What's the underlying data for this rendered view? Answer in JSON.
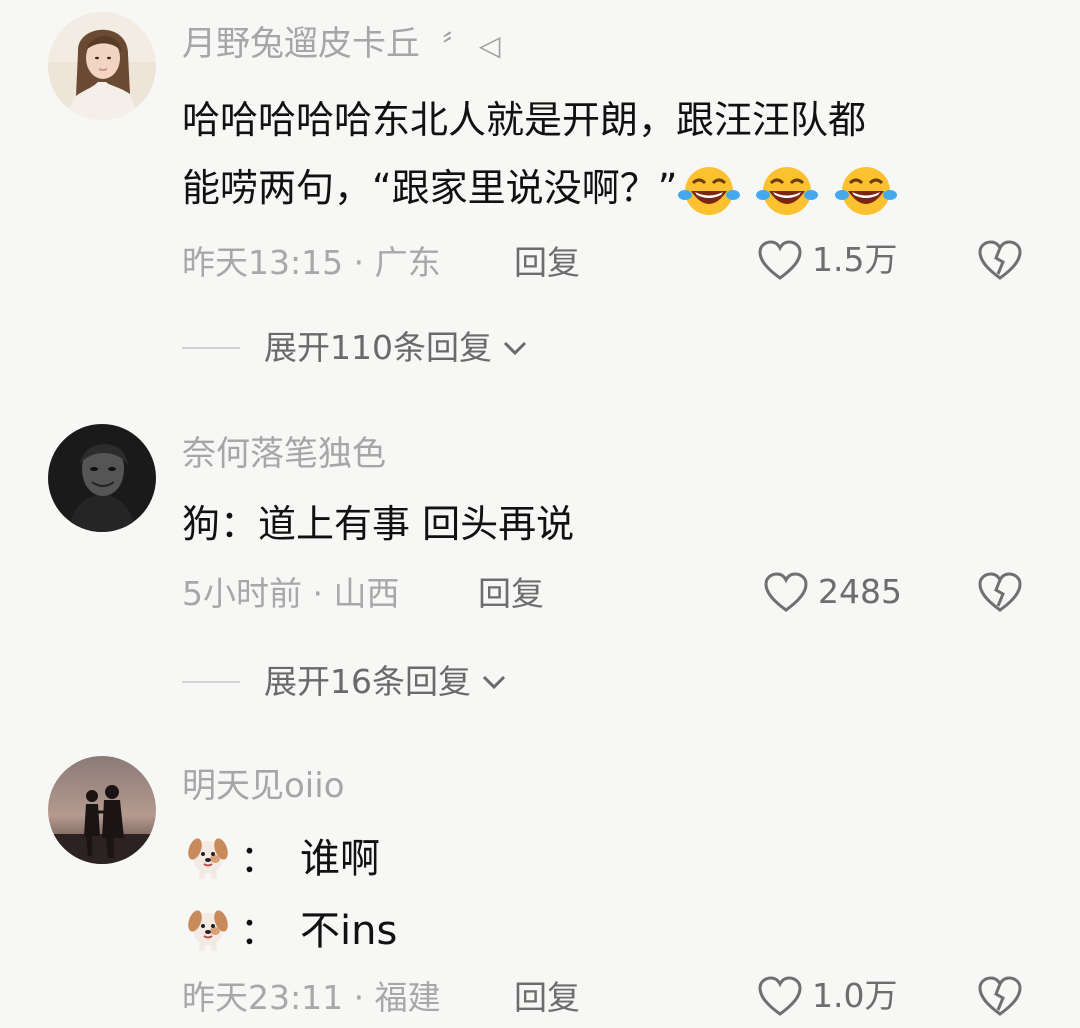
{
  "comments": [
    {
      "username": "月野兔遛皮卡丘",
      "username_suffix": "〞 ◁",
      "text_line1": "哈哈哈哈哈东北人就是开朗，跟汪汪队都",
      "text_line2": "能唠两句，“跟家里说没啊？”",
      "emoji": [
        "crying-laughing-emoji",
        "crying-laughing-emoji",
        "crying-laughing-emoji"
      ],
      "meta": "昨天13:15 · 广东",
      "reply_label": "回复",
      "likes": "1.5万",
      "expand_label": "展开110条回复"
    },
    {
      "username": "奈何落笔独色",
      "text_line1": "狗：道上有事 回头再说",
      "meta": "5小时前 · 山西",
      "reply_label": "回复",
      "likes": "2485",
      "expand_label": "展开16条回复"
    },
    {
      "username": "明天见oiio",
      "dog_lines": [
        "谁啊",
        "不ins"
      ],
      "dog_colon": "：",
      "meta": "昨天23:11 · 福建",
      "reply_label": "回复",
      "likes": "1.0万"
    }
  ],
  "colors": {
    "background": "#f7f7f5",
    "username": "#a6a6a6",
    "body": "#111111",
    "meta": "#a8a8a8",
    "action": "#6d6d6d"
  }
}
